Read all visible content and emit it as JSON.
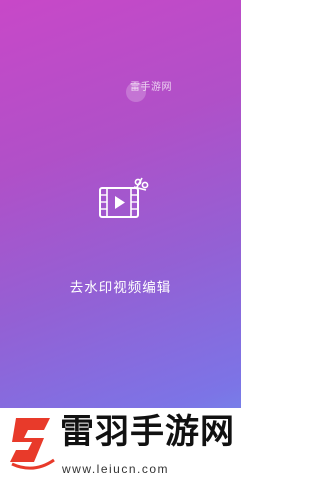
{
  "watermark": {
    "text": "雷手游网"
  },
  "main": {
    "title": "去水印视频编辑",
    "icon": "video-edit-icon"
  },
  "footer": {
    "site_name": "雷羽手游网",
    "url": "www.leiucn.com",
    "logo_icon": "leiyu-logo-icon"
  },
  "colors": {
    "gradient_top": "#c848c8",
    "gradient_mid": "#9460d4",
    "gradient_bottom": "#68a0f0",
    "logo_red": "#e83a2a"
  }
}
